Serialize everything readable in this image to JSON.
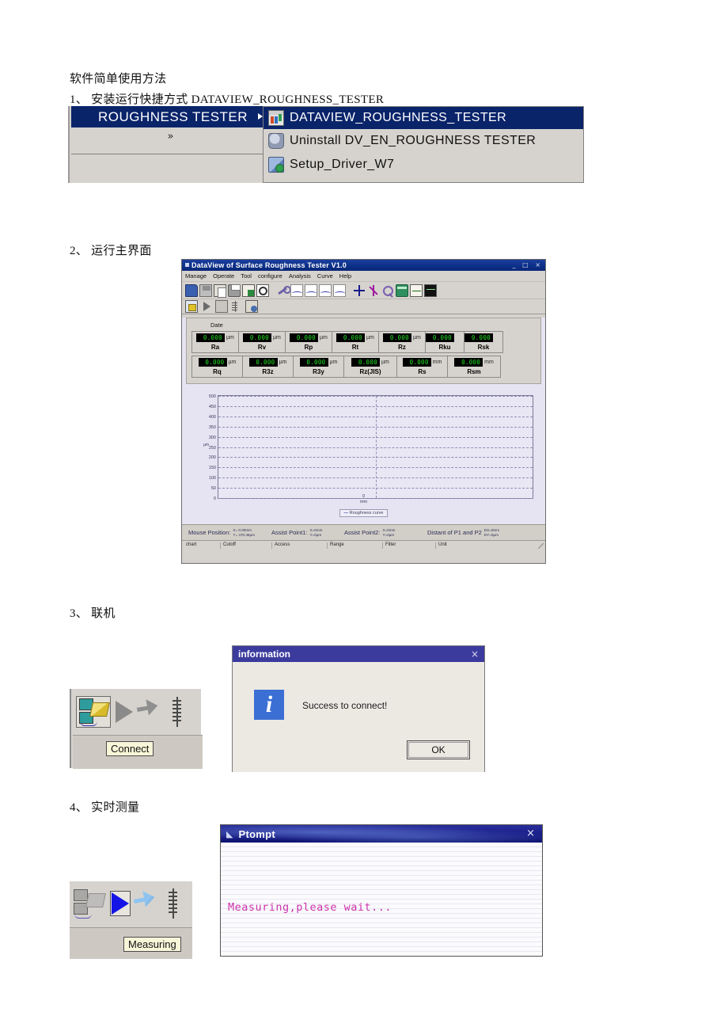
{
  "document": {
    "heading": "软件简单使用方法",
    "step1": "1、 安装运行快捷方式 DATAVIEW_ROUGHNESS_TESTER",
    "step2": "2、 运行主界面",
    "step3": "3、 联机",
    "step4": "4、 实时测量"
  },
  "start_menu": {
    "parent_label": "ROUGHNESS TESTER",
    "chevron": "»",
    "items": [
      {
        "label": "DATAVIEW_ROUGHNESS_TESTER",
        "icon": "app-icon",
        "selected": true
      },
      {
        "label": "Uninstall DV_EN_ROUGHNESS TESTER",
        "icon": "uninstall-icon",
        "selected": false
      },
      {
        "label": "Setup_Driver_W7",
        "icon": "setup-icon",
        "selected": false
      }
    ]
  },
  "main_window": {
    "title": "DataView of Surface Roughness Tester  V1.0",
    "window_buttons": "_ □ ×",
    "menu": [
      "Manage",
      "Operate",
      "Tool",
      "configure",
      "Analysis",
      "Curve",
      "Help"
    ],
    "toolbar_row1": [
      "open-folder-icon",
      "save-icon",
      "copy-icon",
      "print-icon",
      "export-doc-icon",
      "print-preview-icon",
      "settings-wrench-icon",
      "profile-p-curve-icon",
      "profile-r-curve-icon",
      "profile-rk-curve-icon",
      "slope-curve-icon",
      "crosshair-icon",
      "star-marker-icon",
      "zoom-icon",
      "layers-icon",
      "chart-icon",
      "screen-icon"
    ],
    "toolbar_row2": [
      "connect-icon",
      "play-icon",
      "transfer-icon",
      "measure-range-icon",
      "device-setup-icon"
    ],
    "date_label": "Date",
    "measurements_row1": [
      {
        "name": "Ra",
        "value": "0.000",
        "unit": "µm"
      },
      {
        "name": "Rv",
        "value": "0.000",
        "unit": "µm"
      },
      {
        "name": "Rp",
        "value": "0.000",
        "unit": "µm"
      },
      {
        "name": "Rt",
        "value": "0.000",
        "unit": "µm"
      },
      {
        "name": "Rz",
        "value": "0.000",
        "unit": "µm"
      },
      {
        "name": "Rku",
        "value": "0.000",
        "unit": ""
      },
      {
        "name": "Rsk",
        "value": "0.000",
        "unit": ""
      }
    ],
    "measurements_row2": [
      {
        "name": "Rq",
        "value": "0.000",
        "unit": "µm"
      },
      {
        "name": "R3z",
        "value": "0.000",
        "unit": "µm"
      },
      {
        "name": "R3y",
        "value": "0.000",
        "unit": "µm"
      },
      {
        "name": "Rz(JIS)",
        "value": "0.000",
        "unit": "µm"
      },
      {
        "name": "Rs",
        "value": "0.000",
        "unit": "mm"
      },
      {
        "name": "Rsm",
        "value": "0.000",
        "unit": "mm"
      }
    ],
    "status_bar": {
      "mouse_position_label": "Mouse Position:",
      "mouse_position_x": "X=  0.00mm",
      "mouse_position_y": "Y= 470.45µm",
      "assist_point1_label": "Assist Point1:",
      "assist_point1_x": "X=0mm",
      "assist_point1_y": "Y=0µm",
      "assist_point2_label": "Assist Point2:",
      "assist_point2_x": "X=0mm",
      "assist_point2_y": "Y=0µm",
      "distance_label": "Distant of P1 and P2",
      "distance_x": "DX=0mm",
      "distance_y": "DY=0µm"
    },
    "status_fields": [
      "chart",
      "Cutoff",
      "Access",
      "Range",
      "Filter",
      "Unit"
    ]
  },
  "chart_data": {
    "type": "line",
    "title": "",
    "xlabel": "mm",
    "ylabel": "µm",
    "legend": "Roughness curve",
    "legend_position": "bottom-center",
    "grid": true,
    "ylim": [
      0,
      500
    ],
    "yticks": [
      0,
      50,
      100,
      150,
      200,
      250,
      300,
      350,
      400,
      450,
      500
    ],
    "xticks": [
      0
    ],
    "xticklabels": [
      "0"
    ],
    "series": [
      {
        "name": "Roughness curve",
        "color": "#3b3bb0",
        "x": [],
        "y": []
      }
    ]
  },
  "connect": {
    "tooltip": "Connect",
    "icons": [
      "connect-icon",
      "play-icon",
      "transfer-icon",
      "ruler-icon"
    ]
  },
  "info_dialog": {
    "title": "information",
    "close": "×",
    "icon": "info-icon",
    "message": "Success to connect!",
    "ok_label": "OK"
  },
  "measuring": {
    "tooltip": "Measuring",
    "icons": [
      "connect-icon",
      "play-icon",
      "transfer-icon",
      "ruler-icon"
    ]
  },
  "ptompt_window": {
    "title": "Ptompt",
    "title_icon": "window-icon",
    "close": "×",
    "message": "Measuring,please wait...",
    "message_color": "#cc33aa"
  }
}
